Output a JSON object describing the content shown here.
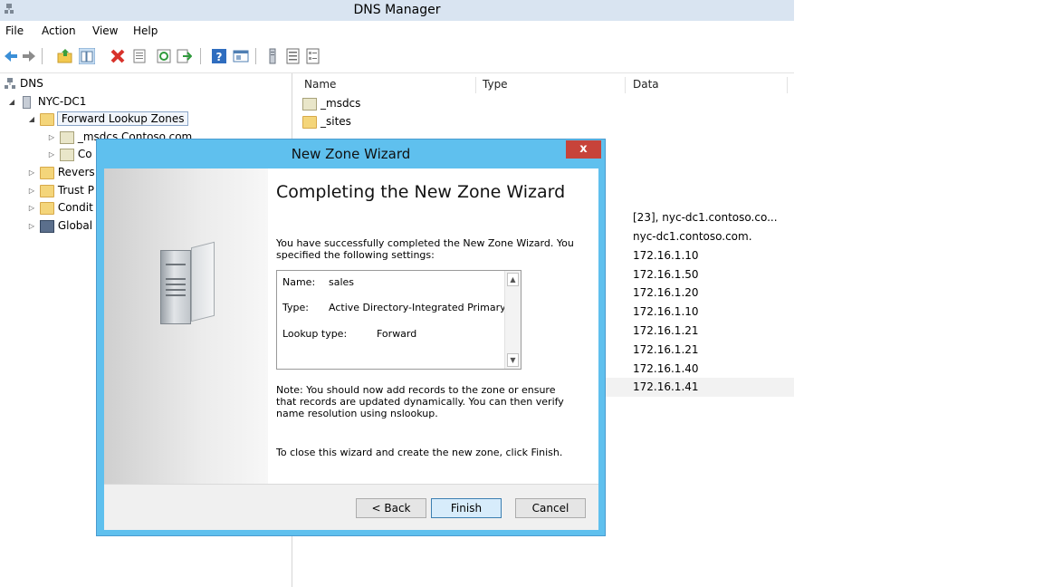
{
  "window": {
    "title": "DNS Manager"
  },
  "menu": [
    "File",
    "Action",
    "View",
    "Help"
  ],
  "toolbar_icons": [
    "back-icon",
    "forward-icon",
    "up-folder-icon",
    "show-tree-icon",
    "delete-icon",
    "properties-icon",
    "refresh-icon",
    "export-icon",
    "help-icon",
    "console-icon",
    "server-icon",
    "list-icon",
    "records-icon"
  ],
  "tree": {
    "root": "DNS",
    "server": "NYC-DC1",
    "forward_zones": "Forward Lookup Zones",
    "zone1": "_msdcs.Contoso.com",
    "zone2": "Co",
    "reverse": "Revers",
    "trust": "Trust P",
    "conditional": "Condit",
    "global": "Global"
  },
  "list": {
    "headers": {
      "name": "Name",
      "type": "Type",
      "data": "Data"
    },
    "rows_top": [
      "_msdcs",
      "_sites"
    ],
    "data_values": [
      "[23], nyc-dc1.contoso.co...",
      "nyc-dc1.contoso.com.",
      "172.16.1.10",
      "172.16.1.50",
      "172.16.1.20",
      "172.16.1.10",
      "172.16.1.21",
      "172.16.1.21",
      "172.16.1.40",
      "172.16.1.41"
    ]
  },
  "dialog": {
    "title": "New Zone Wizard",
    "close": "x",
    "heading": "Completing the New Zone Wizard",
    "intro": "You have successfully completed the New Zone Wizard. You specified the following settings:",
    "summary": {
      "name_label": "Name:",
      "name_value": "sales",
      "type_label": "Type:",
      "type_value": "Active Directory-Integrated Primary",
      "lookup_label": "Lookup type:",
      "lookup_value": "Forward"
    },
    "note": "Note: You should now add records to the zone or ensure that records are updated dynamically. You can then verify name resolution using nslookup.",
    "close_text": "To close this wizard and create the new zone, click Finish.",
    "buttons": {
      "back": "< Back",
      "finish": "Finish",
      "cancel": "Cancel"
    }
  }
}
